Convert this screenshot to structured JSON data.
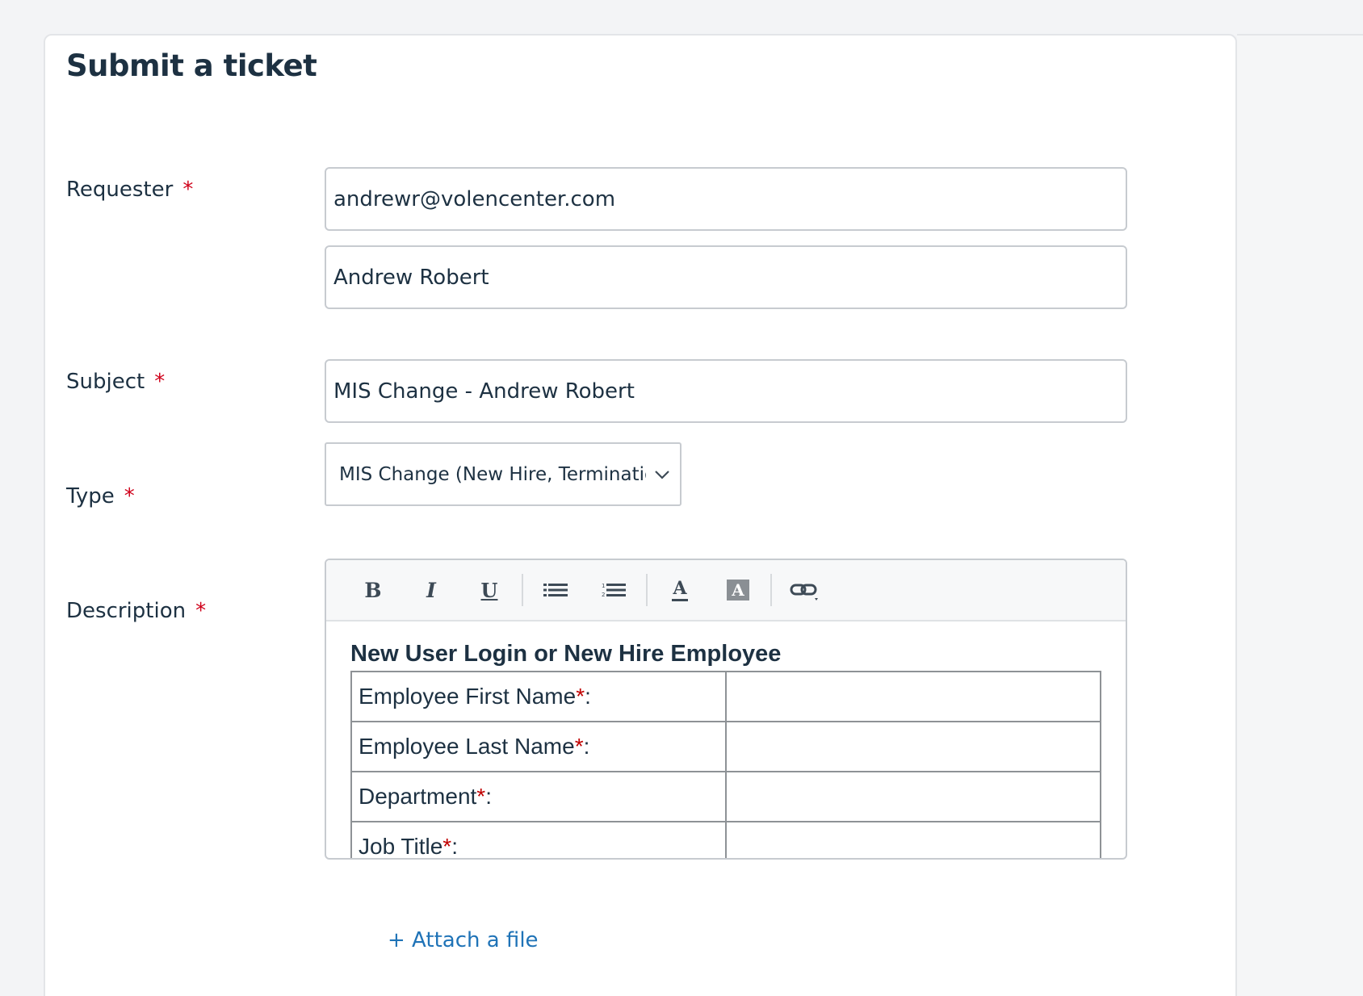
{
  "form": {
    "title": "Submit a ticket",
    "required_marker": "*",
    "requester": {
      "label": "Requester",
      "email": "andrewr@volencenter.com",
      "name": "Andrew Robert"
    },
    "subject": {
      "label": "Subject",
      "value": "MIS Change - Andrew Robert"
    },
    "type": {
      "label": "Type",
      "selected": "MIS Change (New Hire, Termination,"
    },
    "description": {
      "label": "Description",
      "toolbar": {
        "bold": "B",
        "italic": "I",
        "underline": "U",
        "text_color": "A",
        "bg_color": "A"
      },
      "heading": "New User Login or New Hire Employee",
      "rows": [
        {
          "label": "Employee First Name",
          "marker": "*",
          "suffix": ":",
          "value": ""
        },
        {
          "label": "Employee Last Name",
          "marker": "*",
          "suffix": ":",
          "value": ""
        },
        {
          "label": "Department",
          "marker": "*",
          "suffix": ":",
          "value": ""
        },
        {
          "label": "Job Title",
          "marker": "*",
          "suffix": ":",
          "value": ""
        }
      ]
    },
    "attach_label": "+ Attach a file"
  },
  "colors": {
    "accent": "#1f73b7",
    "required": "#d0021b",
    "text": "#1d3142"
  }
}
